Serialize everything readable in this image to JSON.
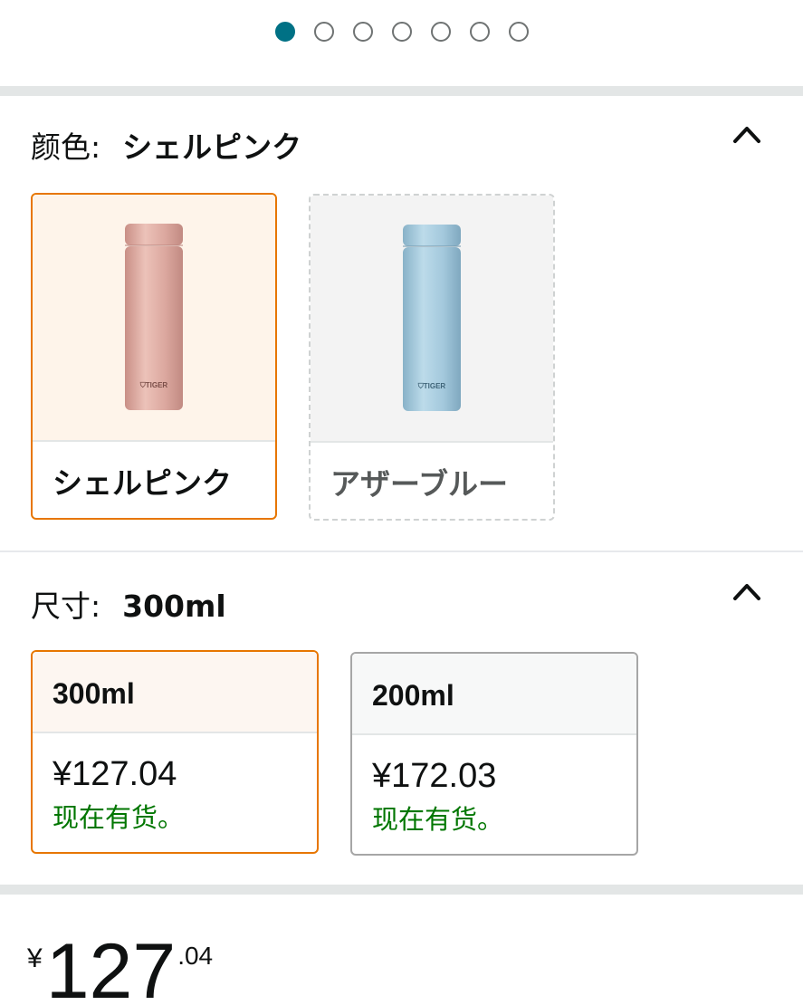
{
  "carousel": {
    "count": 7,
    "active": 0
  },
  "color_section": {
    "label": "颜色:",
    "selected_value": "シェルピンク",
    "options": [
      {
        "name": "シェルピンク",
        "state": "selected",
        "bottle_color": "#d9a79e",
        "brand": "TIGER"
      },
      {
        "name": "アザーブルー",
        "state": "unavailable",
        "bottle_color": "#9cc3d8",
        "brand": "TIGER"
      }
    ]
  },
  "size_section": {
    "label": "尺寸:",
    "selected_value": "300ml",
    "options": [
      {
        "title": "300ml",
        "price": "¥127.04",
        "stock": "现在有货。",
        "state": "selected"
      },
      {
        "title": "200ml",
        "price": "¥172.03",
        "stock": "现在有货。",
        "state": "normal"
      }
    ]
  },
  "price": {
    "symbol": "¥",
    "whole": "127",
    "fraction": ".04"
  },
  "colors": {
    "accent_selected": "#e77600",
    "in_stock": "#007600",
    "carousel_active": "#007185"
  }
}
